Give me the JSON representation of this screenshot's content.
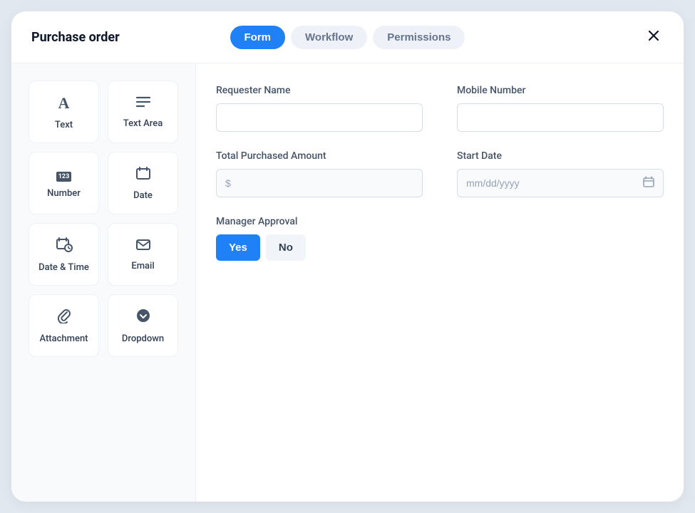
{
  "header": {
    "title": "Purchase order",
    "tabs": [
      {
        "label": "Form"
      },
      {
        "label": "Workflow"
      },
      {
        "label": "Permissions"
      }
    ]
  },
  "palette": [
    {
      "icon": "text",
      "label": "Text"
    },
    {
      "icon": "textarea",
      "label": "Text Area"
    },
    {
      "icon": "number",
      "label": "Number",
      "badge": "123"
    },
    {
      "icon": "date",
      "label": "Date"
    },
    {
      "icon": "datetime",
      "label": "Date & Time"
    },
    {
      "icon": "email",
      "label": "Email"
    },
    {
      "icon": "attachment",
      "label": "Attachment"
    },
    {
      "icon": "dropdown",
      "label": "Dropdown"
    }
  ],
  "fields": {
    "requester_name": {
      "label": "Requester Name",
      "value": ""
    },
    "mobile_number": {
      "label": "Mobile Number",
      "value": ""
    },
    "total_purchased": {
      "label": "Total Purchased Amount",
      "value": "",
      "placeholder": "$"
    },
    "start_date": {
      "label": "Start Date",
      "value": "",
      "placeholder": "mm/dd/yyyy"
    },
    "manager_approval": {
      "label": "Manager Approval",
      "options": {
        "yes": "Yes",
        "no": "No"
      },
      "value": "Yes"
    }
  }
}
